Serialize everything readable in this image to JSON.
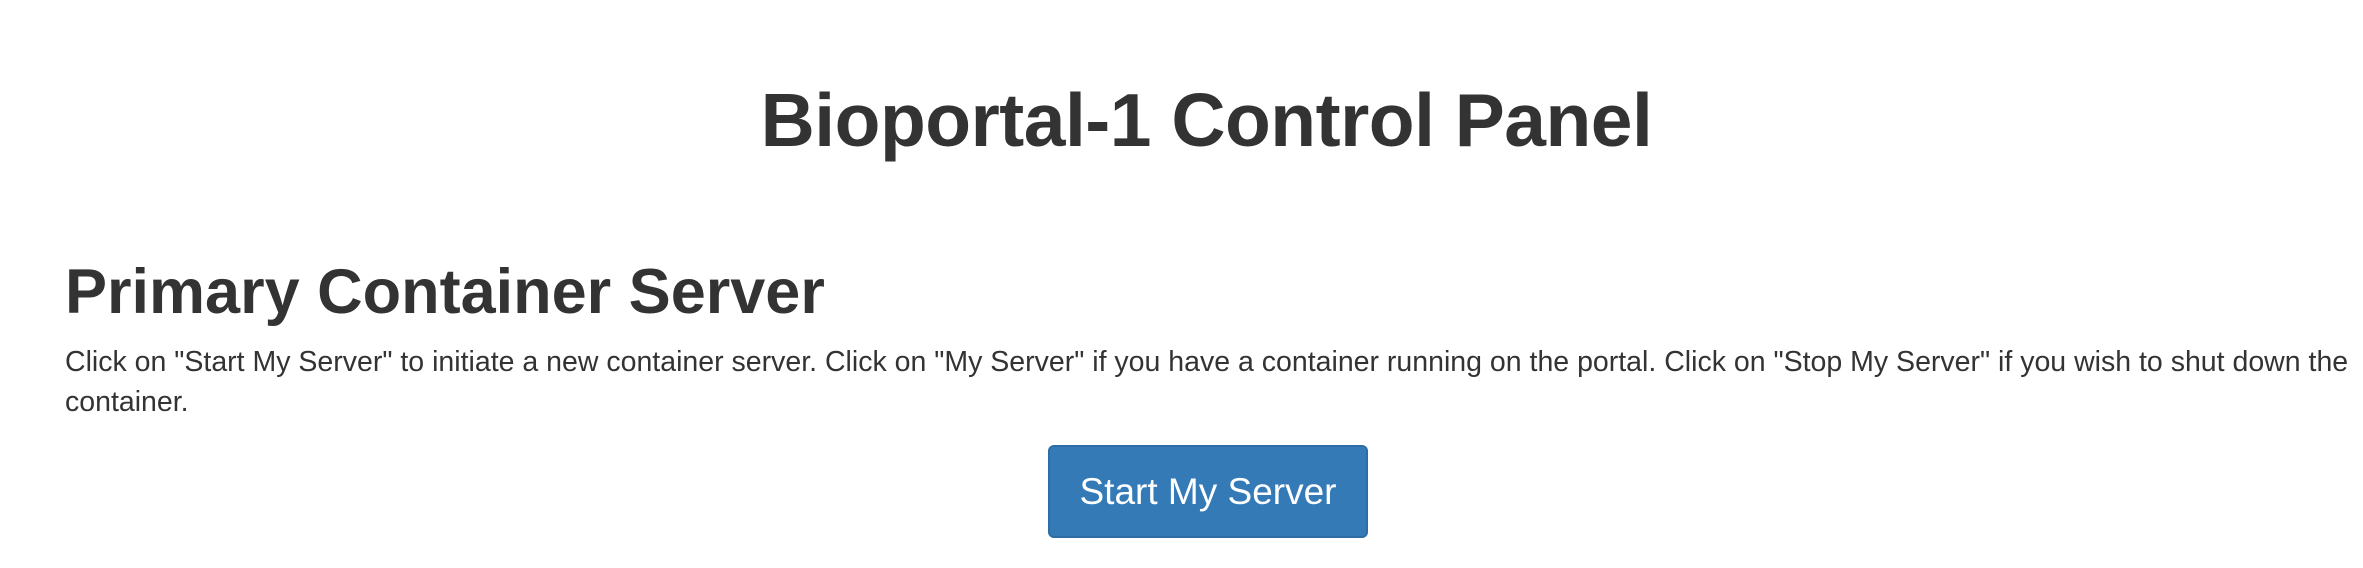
{
  "page": {
    "title": "Bioportal-1 Control Panel"
  },
  "section": {
    "title": "Primary Container Server",
    "description": "Click on \"Start My Server\" to initiate a new container server. Click on \"My Server\" if you have a container running on the portal. Click on \"Stop My Server\" if you wish to shut down the container."
  },
  "actions": {
    "start_label": "Start My Server"
  },
  "colors": {
    "primary_button": "#337ab7",
    "primary_button_border": "#2e6da4",
    "text": "#333333"
  }
}
